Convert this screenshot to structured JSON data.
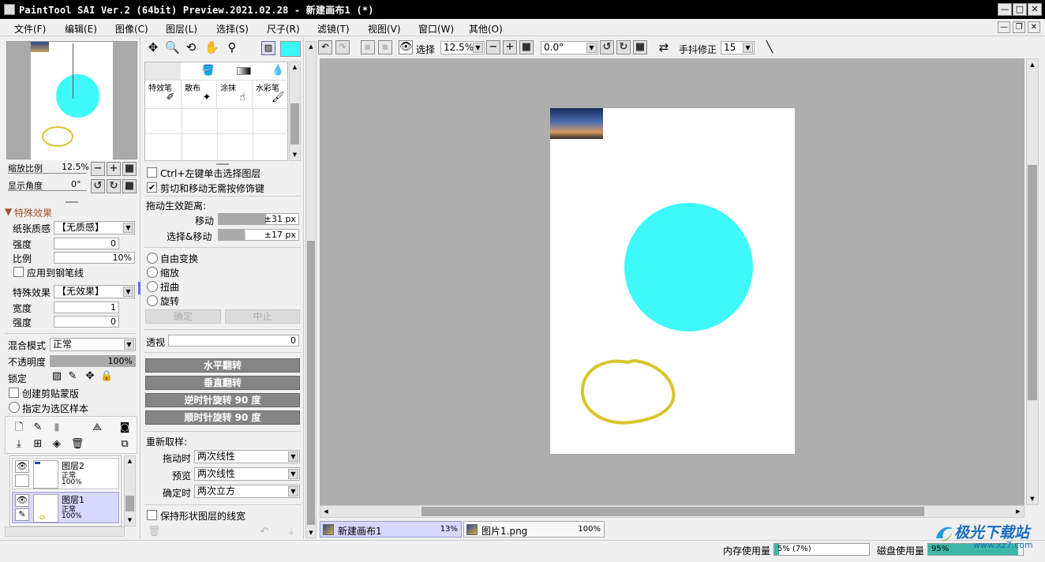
{
  "window": {
    "title": "PaintTool SAI Ver.2 (64bit) Preview.2021.02.28 - 新建画布1 (*)",
    "min_label": "—",
    "max_label": "□",
    "close_label": "✕"
  },
  "menu": [
    "文件(F)",
    "编辑(E)",
    "图像(C)",
    "图层(L)",
    "选择(S)",
    "尺子(R)",
    "滤镜(T)",
    "视图(V)",
    "窗口(W)",
    "其他(O)"
  ],
  "navigator": {
    "zoom_label": "缩放比例",
    "zoom_value": "12.5%",
    "angle_label": "显示角度",
    "angle_value": "0°"
  },
  "effects": {
    "header": "特殊效果",
    "paper_label": "纸张质感",
    "paper_value": "【无质感】",
    "strength_label": "强度",
    "strength_value": "0",
    "scale_label": "比例",
    "scale_value": "10%",
    "apply_label": "应用到钢笔线",
    "effect_label": "特殊效果",
    "effect_value": "【无效果】",
    "width_label": "宽度",
    "width_value": "1",
    "strength2_label": "强度",
    "strength2_value": "0"
  },
  "layer_props": {
    "blend_label": "混合模式",
    "blend_value": "正常",
    "opacity_label": "不透明度",
    "opacity_value": "100%",
    "lock_label": "锁定",
    "clip_label": "创建剪贴蒙版",
    "sample_label": "指定为选区样本"
  },
  "layers": [
    {
      "name": "图层2",
      "mode": "正常",
      "opacity": "100%"
    },
    {
      "name": "图层1",
      "mode": "正常",
      "opacity": "100%"
    }
  ],
  "tools": {
    "color_hex": "#37f7f7",
    "brushes": [
      "特效笔",
      "散布",
      "涂抹",
      "水彩笔"
    ]
  },
  "move_options": {
    "ctrl_click_label": "Ctrl+左键单击选择图层",
    "cut_move_label": "剪切和移动无需按修饰键",
    "drag_distance_label": "拖动生效距离:",
    "move_label": "移动",
    "move_value": "±31 px",
    "select_move_label": "选择&移动",
    "select_move_value": "±17 px",
    "transforms": [
      "自由变换",
      "缩放",
      "扭曲",
      "旋转"
    ],
    "ok_label": "确定",
    "cancel_label": "中止",
    "perspective_label": "透视",
    "perspective_value": "0",
    "flip_h": "水平翻转",
    "flip_v": "垂直翻转",
    "rot_ccw": "逆时针旋转 90 度",
    "rot_cw": "顺时针旋转 90 度",
    "resample_label": "重新取样:",
    "drag_label": "拖动时",
    "drag_value": "两次线性",
    "preview_label": "预览",
    "preview_value": "两次线性",
    "confirm_label": "确定时",
    "confirm_value": "两次立方",
    "keep_width_label": "保持形状图层的线宽"
  },
  "canvas_toolbar": {
    "select_label": "选择",
    "zoom_value": "12.5%",
    "angle_value": "0.0°",
    "stab_label": "手抖修正",
    "stab_value": "15"
  },
  "canvas": {
    "circle_color": "#3ff8f8",
    "stroke_color": "#d9c42c"
  },
  "tabs": [
    {
      "name": "新建画布1",
      "pct": "13%"
    },
    {
      "name": "图片1.png",
      "pct": "100%"
    }
  ],
  "status": {
    "mem_label": "内存使用量",
    "mem_value": "5% (7%)",
    "mem_fraction": 0.05,
    "disk_label": "磁盘使用量",
    "disk_value": "95%",
    "disk_fraction": 0.95
  },
  "watermark": {
    "text": "极光下载站",
    "url": "www.xz7.com"
  }
}
